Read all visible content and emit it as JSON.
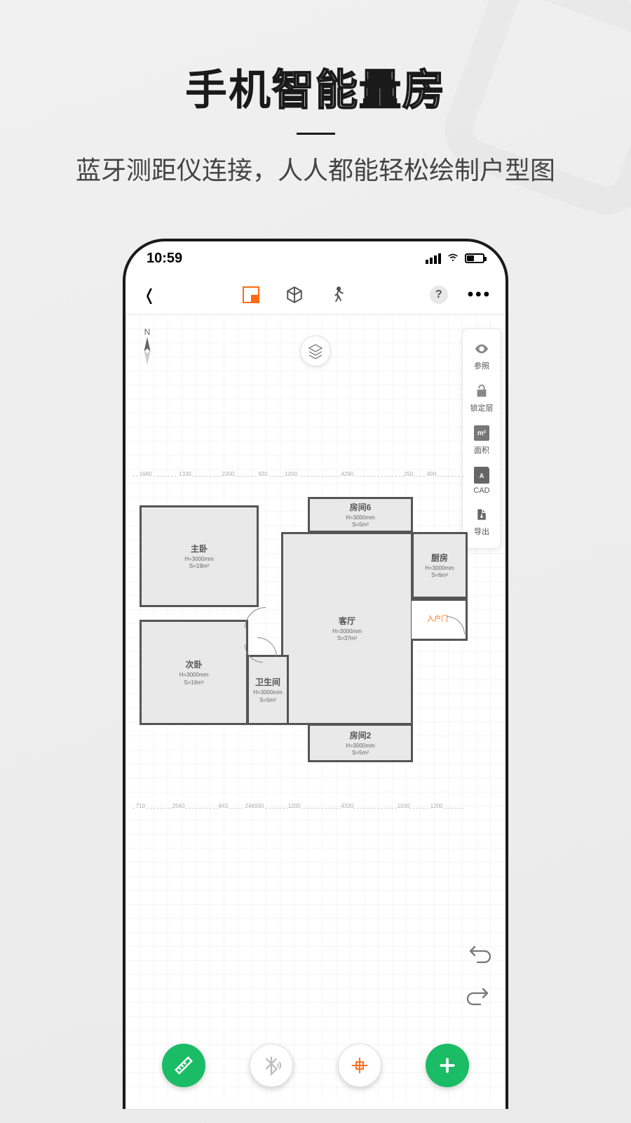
{
  "hero": {
    "title_plain": "手机",
    "title_outline": "智能量房",
    "subtitle": "蓝牙测距仪连接，人人都能轻松绘制户型图"
  },
  "statusbar": {
    "time": "10:59"
  },
  "toolbar": {
    "back": "‹",
    "help": "?",
    "more": "•••"
  },
  "compass": {
    "label": "N"
  },
  "side_panel": [
    {
      "key": "reference",
      "label": "参照"
    },
    {
      "key": "lock",
      "label": "锁定层"
    },
    {
      "key": "area",
      "label": "面积",
      "icon_text": "m²"
    },
    {
      "key": "cad",
      "label": "CAD",
      "icon_text": "A"
    },
    {
      "key": "export",
      "label": "导出"
    }
  ],
  "dimensions_top": [
    "1660",
    "1330",
    "2300",
    "930",
    "1200",
    "4290",
    "250",
    "600"
  ],
  "dimensions_bot": [
    "710",
    "2560",
    "843",
    "246930",
    "1200",
    "4330",
    "1030",
    "1200"
  ],
  "rooms": {
    "master": {
      "name": "主卧",
      "h": "H=3000mm",
      "s": "S=19m²"
    },
    "second": {
      "name": "次卧",
      "h": "H=3000mm",
      "s": "S=16m²"
    },
    "bath": {
      "name": "卫生间",
      "h": "H=3000mm",
      "s": "S=5m²"
    },
    "living": {
      "name": "客厅",
      "h": "H=3000mm",
      "s": "S=37m²"
    },
    "room6": {
      "name": "房间6",
      "h": "H=3000mm",
      "s": "S=5m²"
    },
    "kitchen": {
      "name": "厨房",
      "h": "H=3000mm",
      "s": "S=6m²"
    },
    "room2": {
      "name": "房间2",
      "h": "H=3000mm",
      "s": "S=5m²"
    }
  },
  "entry": {
    "label": "入户门"
  }
}
